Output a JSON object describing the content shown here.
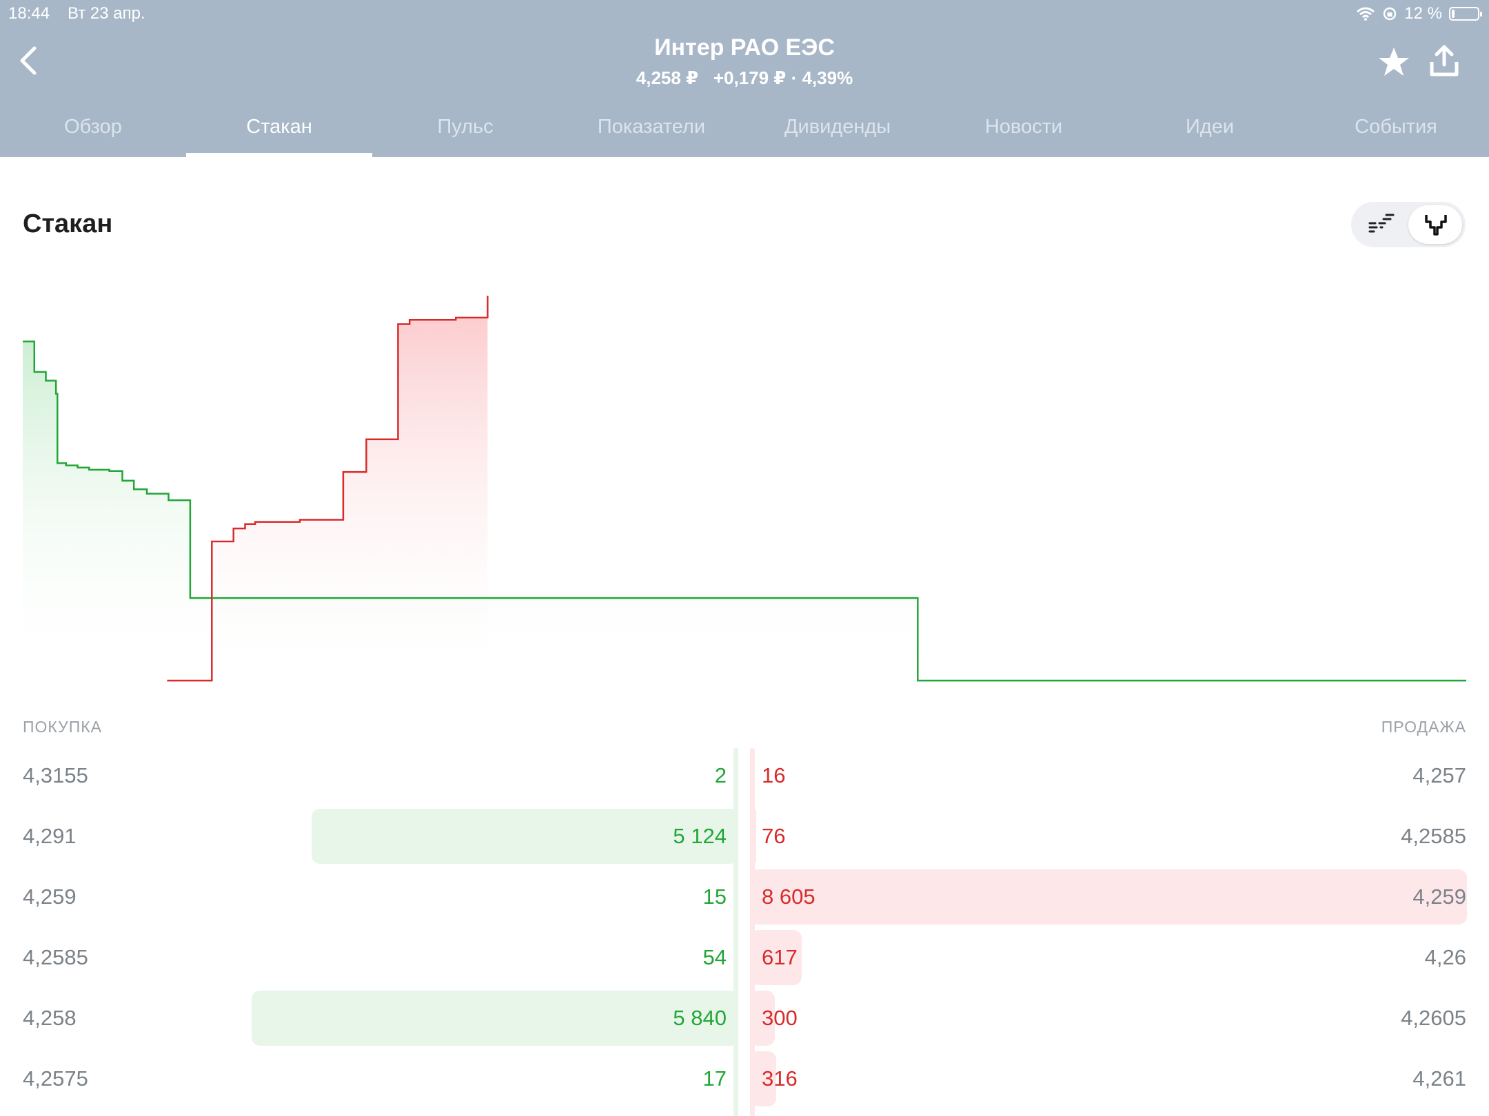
{
  "status_bar": {
    "time": "18:44",
    "date": "Вт 23 апр.",
    "battery": "12 %",
    "battery_fraction": 0.12
  },
  "header": {
    "title": "Интер РАО ЕЭС",
    "price": "4,258 ₽",
    "change": "+0,179 ₽ · 4,39%"
  },
  "tabs": [
    {
      "label": "Обзор",
      "active": false
    },
    {
      "label": "Стакан",
      "active": true
    },
    {
      "label": "Пульс",
      "active": false
    },
    {
      "label": "Показатели",
      "active": false
    },
    {
      "label": "Дивиденды",
      "active": false
    },
    {
      "label": "Новости",
      "active": false
    },
    {
      "label": "Идеи",
      "active": false
    },
    {
      "label": "События",
      "active": false
    }
  ],
  "section": {
    "title": "Стакан"
  },
  "colors": {
    "header_bg": "#a7b7c8",
    "bid": "#21a637",
    "ask": "#d72b2b",
    "bid_fill": "#e8f6ea",
    "ask_fill": "#fde7e8"
  },
  "order_book": {
    "buy_header": "ПОКУПКА",
    "sell_header": "ПРОДАЖА",
    "rows": [
      {
        "bid_price": "4,3155",
        "bid_qty": "2",
        "ask_qty": "16",
        "ask_price": "4,257"
      },
      {
        "bid_price": "4,291",
        "bid_qty": "5 124",
        "ask_qty": "76",
        "ask_price": "4,2585"
      },
      {
        "bid_price": "4,259",
        "bid_qty": "15",
        "ask_qty": "8 605",
        "ask_price": "4,259"
      },
      {
        "bid_price": "4,2585",
        "bid_qty": "54",
        "ask_qty": "617",
        "ask_price": "4,26"
      },
      {
        "bid_price": "4,258",
        "bid_qty": "5 840",
        "ask_qty": "300",
        "ask_price": "4,2605"
      },
      {
        "bid_price": "4,2575",
        "bid_qty": "17",
        "ask_qty": "316",
        "ask_price": "4,261"
      }
    ]
  },
  "chart_data": {
    "type": "area",
    "y_max_volume": 9000,
    "bid_depth": [
      {
        "x": 0.0,
        "v": 7800
      },
      {
        "x": 0.008,
        "v": 7100
      },
      {
        "x": 0.016,
        "v": 6900
      },
      {
        "x": 0.023,
        "v": 6600
      },
      {
        "x": 0.024,
        "v": 5000
      },
      {
        "x": 0.03,
        "v": 4950
      },
      {
        "x": 0.038,
        "v": 4900
      },
      {
        "x": 0.046,
        "v": 4850
      },
      {
        "x": 0.06,
        "v": 4820
      },
      {
        "x": 0.069,
        "v": 4600
      },
      {
        "x": 0.077,
        "v": 4400
      },
      {
        "x": 0.086,
        "v": 4300
      },
      {
        "x": 0.101,
        "v": 4150
      },
      {
        "x": 0.116,
        "v": 3900
      },
      {
        "x": 0.116,
        "v": 1900
      },
      {
        "x": 0.62,
        "v": 1900
      },
      {
        "x": 0.62,
        "v": 0
      },
      {
        "x": 1.0,
        "v": 0
      }
    ],
    "ask_depth": [
      {
        "x": 0.1,
        "v": 0
      },
      {
        "x": 0.131,
        "v": 0
      },
      {
        "x": 0.131,
        "v": 3200
      },
      {
        "x": 0.146,
        "v": 3300
      },
      {
        "x": 0.146,
        "v": 3500
      },
      {
        "x": 0.154,
        "v": 3600
      },
      {
        "x": 0.161,
        "v": 3650
      },
      {
        "x": 0.192,
        "v": 3700
      },
      {
        "x": 0.222,
        "v": 3750
      },
      {
        "x": 0.222,
        "v": 4800
      },
      {
        "x": 0.238,
        "v": 5550
      },
      {
        "x": 0.26,
        "v": 8200
      },
      {
        "x": 0.268,
        "v": 8300
      },
      {
        "x": 0.3,
        "v": 8350
      },
      {
        "x": 0.322,
        "v": 8850
      }
    ]
  }
}
